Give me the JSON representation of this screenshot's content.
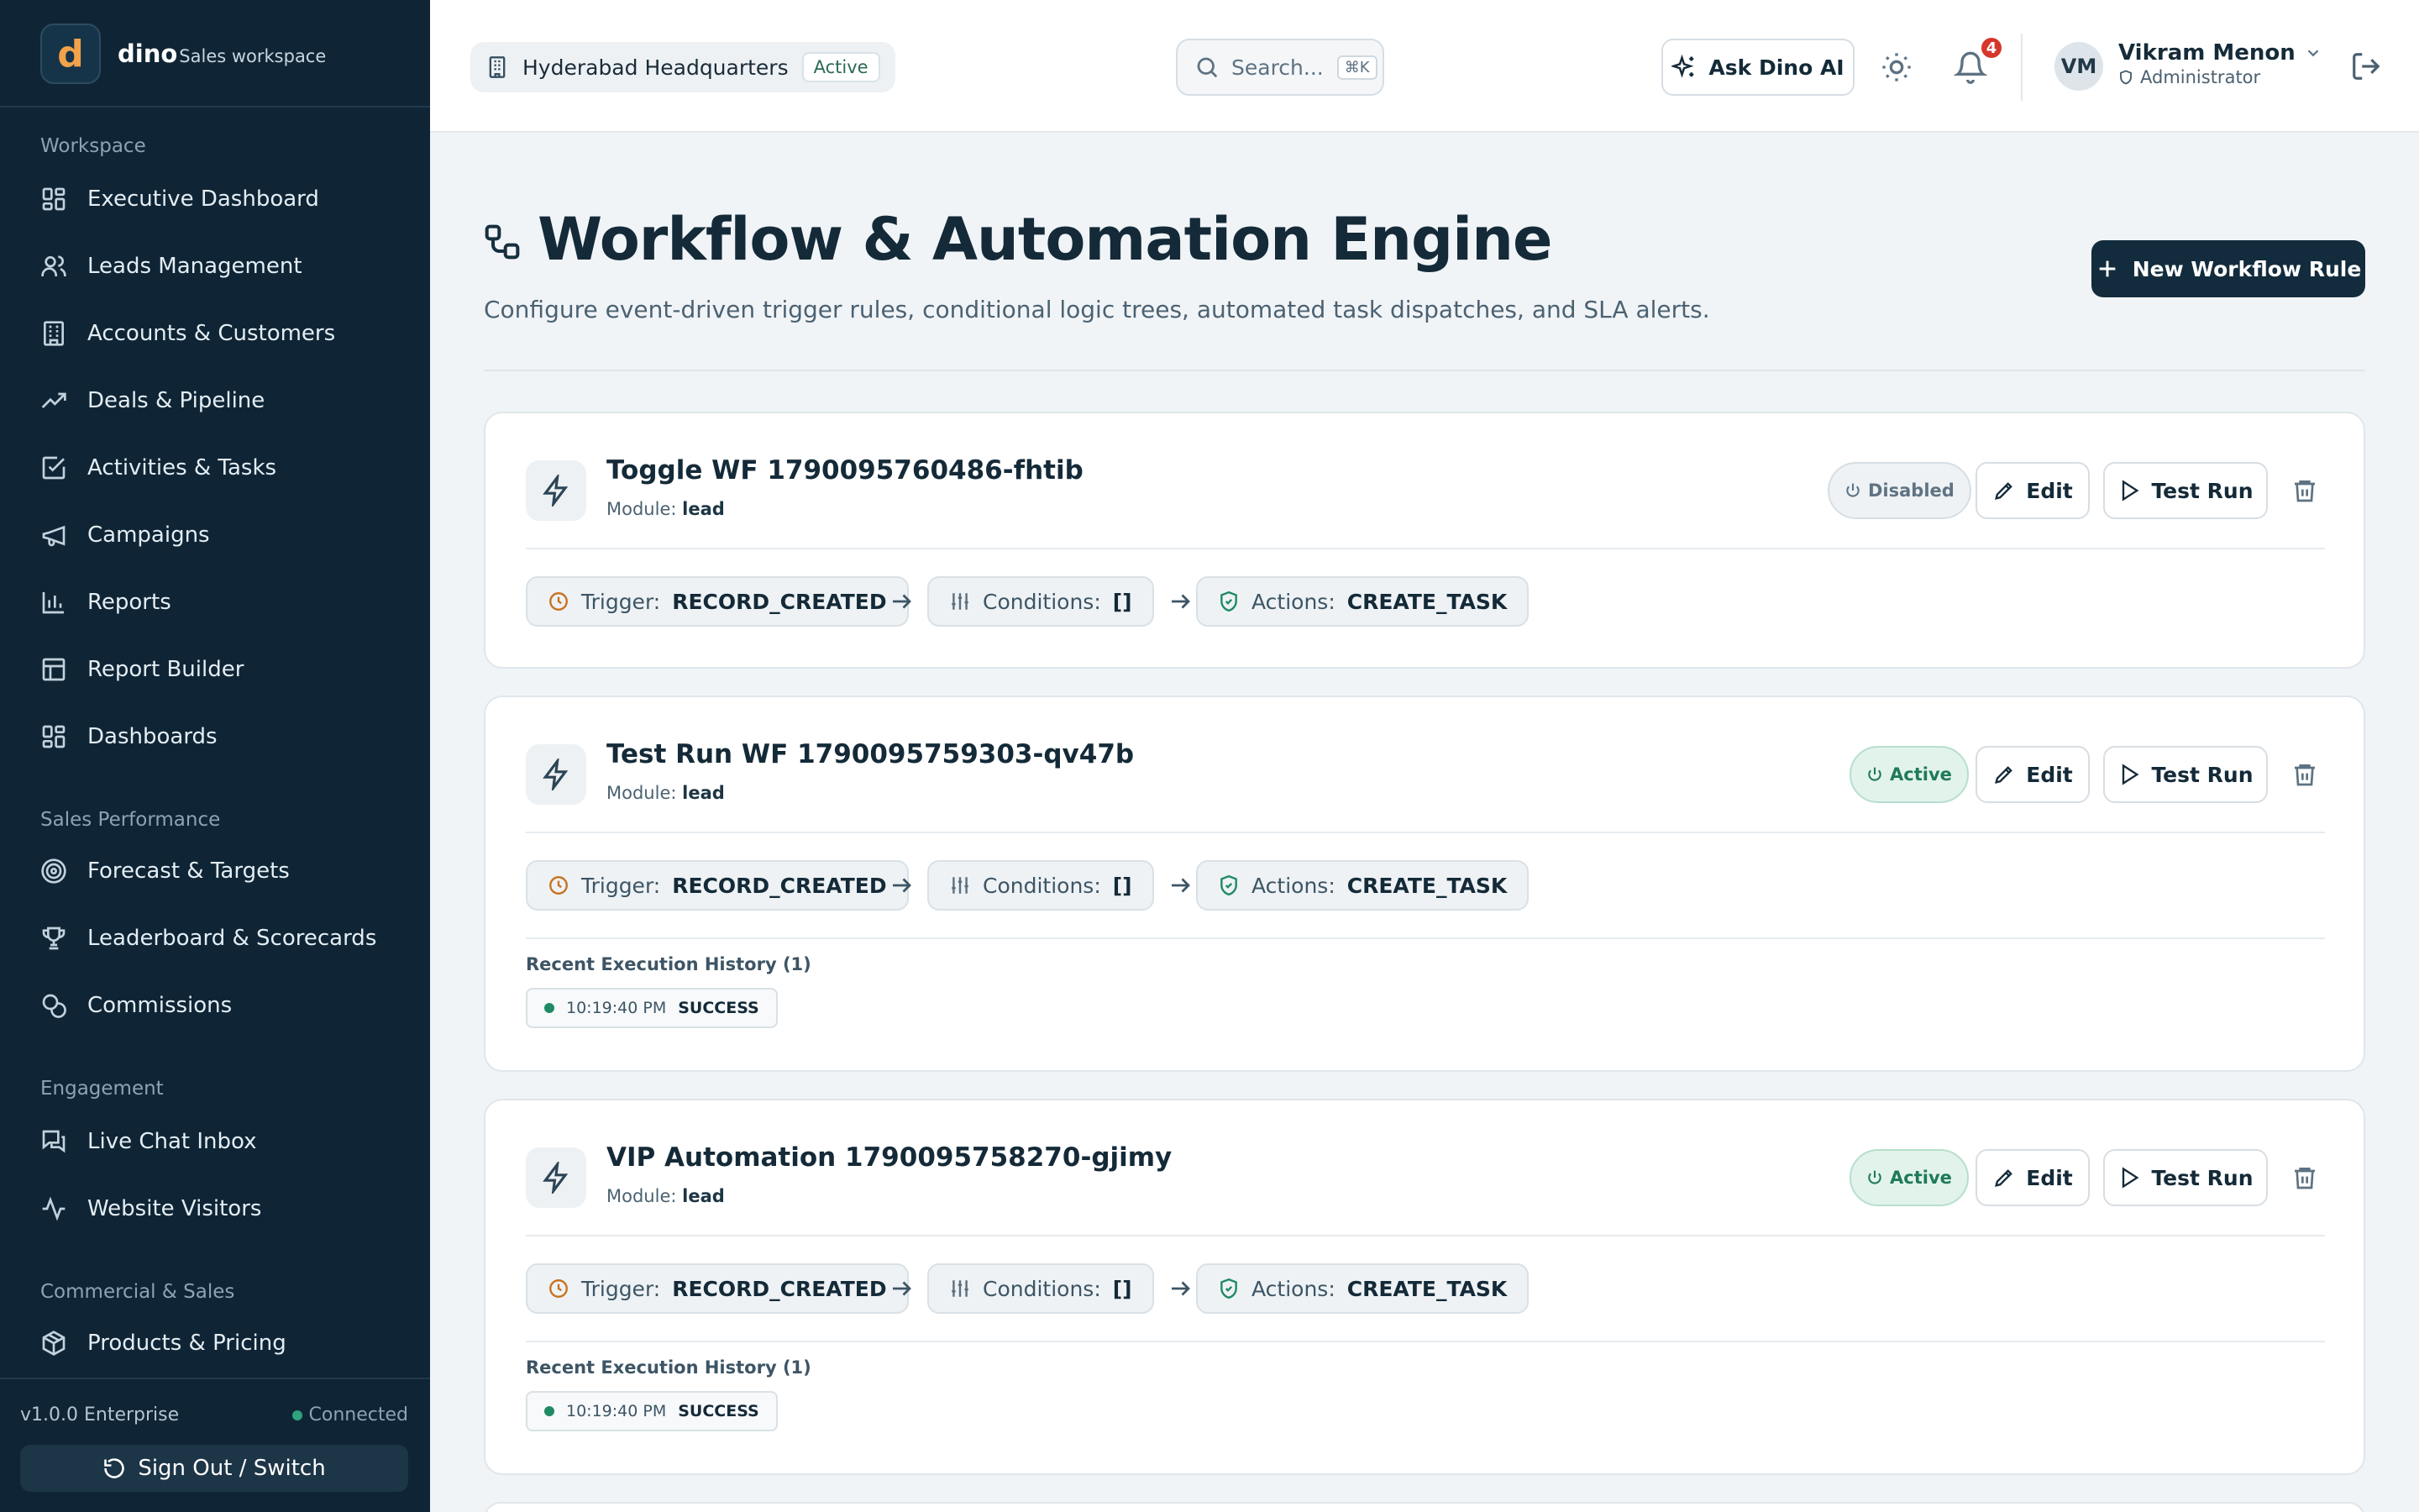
{
  "brand": {
    "logo_letter": "d",
    "name": "dino",
    "subtitle": "Sales workspace"
  },
  "sidebar": {
    "groups": [
      {
        "label": "Workspace",
        "items": [
          {
            "label": "Executive Dashboard",
            "icon": "dashboard-icon"
          },
          {
            "label": "Leads Management",
            "icon": "users-icon"
          },
          {
            "label": "Accounts & Customers",
            "icon": "building-icon"
          },
          {
            "label": "Deals & Pipeline",
            "icon": "trending-up-icon"
          },
          {
            "label": "Activities & Tasks",
            "icon": "checkbox-icon"
          },
          {
            "label": "Campaigns",
            "icon": "megaphone-icon"
          },
          {
            "label": "Reports",
            "icon": "bar-chart-icon"
          },
          {
            "label": "Report Builder",
            "icon": "table-icon"
          },
          {
            "label": "Dashboards",
            "icon": "dashboard-icon"
          }
        ]
      },
      {
        "label": "Sales Performance",
        "items": [
          {
            "label": "Forecast & Targets",
            "icon": "target-icon"
          },
          {
            "label": "Leaderboard & Scorecards",
            "icon": "trophy-icon"
          },
          {
            "label": "Commissions",
            "icon": "coins-icon"
          }
        ]
      },
      {
        "label": "Engagement",
        "items": [
          {
            "label": "Live Chat Inbox",
            "icon": "chat-icon"
          },
          {
            "label": "Website Visitors",
            "icon": "activity-icon"
          }
        ]
      },
      {
        "label": "Commercial & Sales",
        "items": [
          {
            "label": "Products & Pricing",
            "icon": "package-icon"
          }
        ]
      }
    ],
    "footer": {
      "version": "v1.0.0 Enterprise",
      "status": "Connected",
      "sign_out": "Sign Out / Switch"
    }
  },
  "header": {
    "location": "Hyderabad Headquarters",
    "location_status": "Active",
    "search_placeholder": "Search...",
    "search_shortcut": "⌘K",
    "ask_ai": "Ask Dino AI",
    "notifications_count": "4",
    "user": {
      "initials": "VM",
      "name": "Vikram Menon",
      "role": "Administrator"
    }
  },
  "page": {
    "title": "Workflow & Automation Engine",
    "subtitle": "Configure event-driven trigger rules, conditional logic trees, automated task dispatches, and SLA alerts.",
    "new_button": "New Workflow Rule"
  },
  "labels": {
    "module": "Module:",
    "trigger": "Trigger:",
    "conditions": "Conditions:",
    "actions": "Actions:",
    "edit": "Edit",
    "test_run": "Test Run"
  },
  "workflows": [
    {
      "title": "Toggle WF 1790095760486-fhtib",
      "module": "lead",
      "status": "Disabled",
      "trigger": "RECORD_CREATED",
      "conditions": "[]",
      "actions": "CREATE_TASK"
    },
    {
      "title": "Test Run WF 1790095759303-qv47b",
      "module": "lead",
      "status": "Active",
      "trigger": "RECORD_CREATED",
      "conditions": "[]",
      "actions": "CREATE_TASK",
      "history_label": "Recent Execution History (1)",
      "history": [
        {
          "time": "10:19:40 PM",
          "result": "SUCCESS"
        }
      ]
    },
    {
      "title": "VIP Automation 1790095758270-gjimy",
      "module": "lead",
      "status": "Active",
      "trigger": "RECORD_CREATED",
      "conditions": "[]",
      "actions": "CREATE_TASK",
      "history_label": "Recent Execution History (1)",
      "history": [
        {
          "time": "10:19:40 PM",
          "result": "SUCCESS"
        }
      ]
    }
  ],
  "colors": {
    "sidebar_bg": "#0f2535",
    "accent_dark": "#132c3d",
    "active_green": "#1f7a59",
    "brand_orange": "#f2a24a",
    "badge_red": "#d6352b"
  }
}
